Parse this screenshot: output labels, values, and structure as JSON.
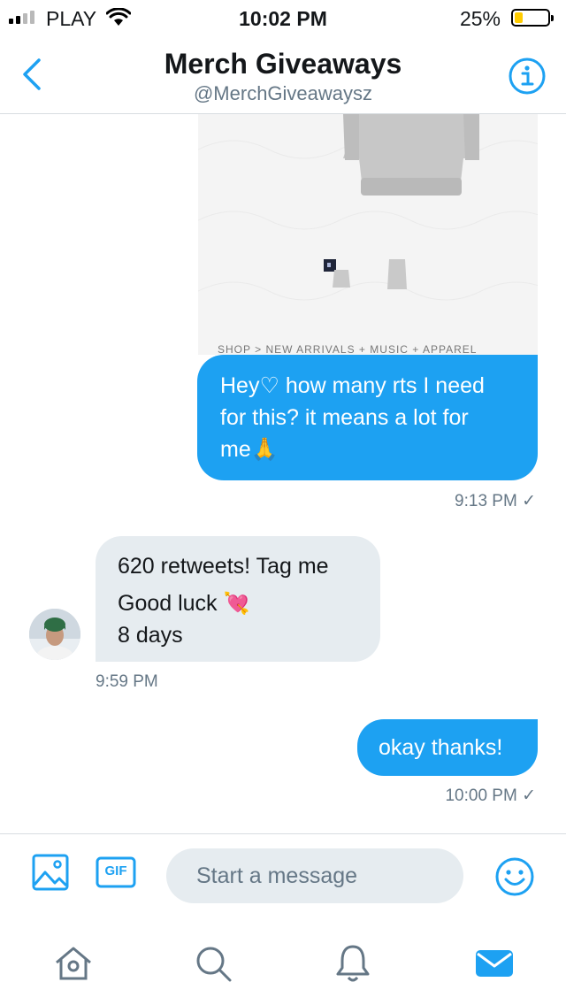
{
  "status_bar": {
    "carrier": "PLAY",
    "time": "10:02 PM",
    "battery_percent": "25%",
    "battery_level": 0.25,
    "signal_bars": 2
  },
  "header": {
    "title": "Merch Giveaways",
    "handle": "@MerchGiveawaysz"
  },
  "product_image": {
    "breadcrumb": "SHOP > NEW ARRIVALS  +  MUSIC  +  APPAREL"
  },
  "messages": [
    {
      "direction": "outgoing",
      "line1": "Hey♡ how many rts I need",
      "line2": "for this? it means a lot for",
      "line3": "me",
      "emoji": "🙏",
      "time": "9:13 PM ✓"
    },
    {
      "direction": "incoming",
      "line1": "620 retweets! Tag me",
      "line2": "Good luck",
      "emoji": "💘",
      "line3": "8 days",
      "time": "9:59 PM"
    },
    {
      "direction": "outgoing",
      "text": "okay thanks!",
      "time": "10:00 PM ✓"
    }
  ],
  "composer": {
    "placeholder": "Start a message",
    "gif_label": "GIF"
  },
  "colors": {
    "accent": "#1da1f2",
    "incoming_bubble": "#e6ecf0",
    "secondary_text": "#657786",
    "battery": "#ffcc00"
  },
  "tabs": [
    "home-icon",
    "search-icon",
    "notifications-icon",
    "messages-icon"
  ],
  "active_tab": "messages-icon"
}
